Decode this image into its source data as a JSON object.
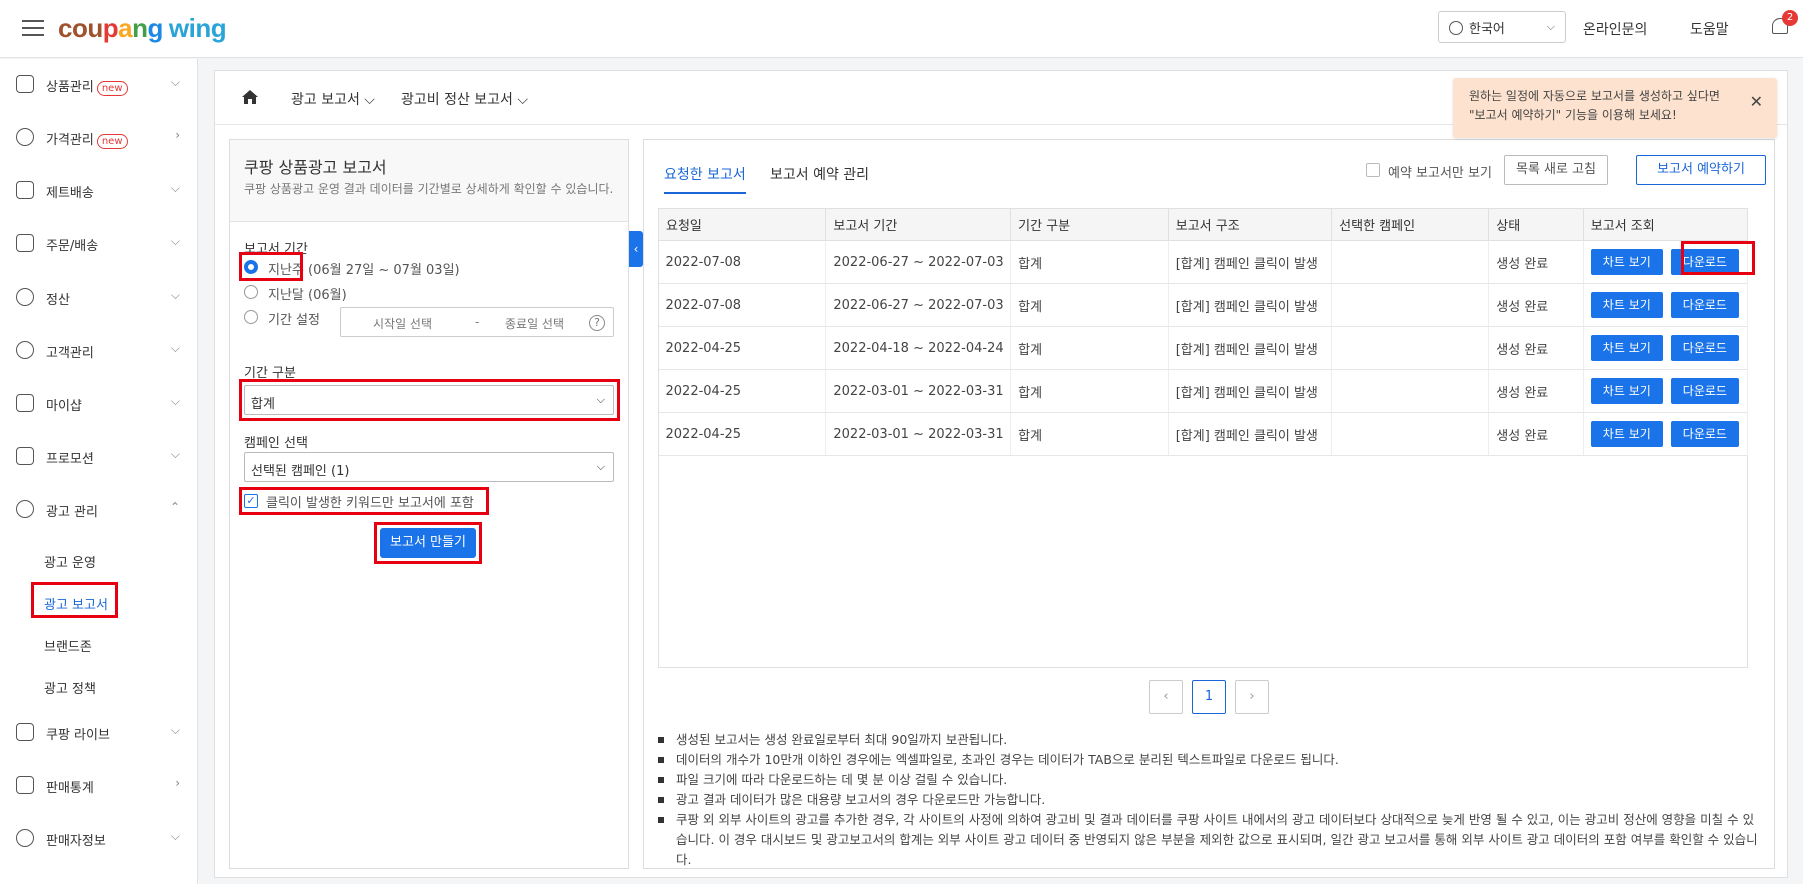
{
  "header": {
    "logo": {
      "c1": "cou",
      "c2": "p",
      "c3": "a",
      "c4": "n",
      "c5": "g",
      "wing": "wing"
    },
    "language": "한국어",
    "links": [
      "온라인문의",
      "도움말"
    ],
    "notification_count": "2"
  },
  "sidebar": {
    "items": [
      {
        "label": "상품관리",
        "new": "new",
        "icon": "box-icon"
      },
      {
        "label": "가격관리",
        "new": "new",
        "icon": "medal-icon"
      },
      {
        "label": "제트배송",
        "icon": "rocket-icon"
      },
      {
        "label": "주문/배송",
        "icon": "truck-icon"
      },
      {
        "label": "정산",
        "icon": "won-icon"
      },
      {
        "label": "고객관리",
        "icon": "smile-icon"
      },
      {
        "label": "마이샵",
        "icon": "shop-icon"
      },
      {
        "label": "프로모션",
        "icon": "ticket-icon"
      },
      {
        "label": "광고 관리",
        "icon": "clock-icon"
      },
      {
        "label": "쿠팡 라이브",
        "icon": "live-icon"
      },
      {
        "label": "판매통계",
        "icon": "chart-icon"
      },
      {
        "label": "판매자정보",
        "icon": "user-icon"
      }
    ],
    "sub_items": [
      "광고 운영",
      "광고 보고서",
      "브랜드존",
      "광고 정책"
    ]
  },
  "breadcrumb": {
    "first": "광고 보고서",
    "second": "광고비 정산 보고서"
  },
  "tooltip": {
    "text": "원하는 일정에 자동으로 보고서를 생성하고 싶다면 \"보고서 예약하기\" 기능을 이용해 보세요!",
    "close": "✕"
  },
  "left_panel": {
    "title": "쿠팡 상품광고 보고서",
    "description": "쿠팡 상품광고 운영 결과 데이터를 기간별로 상세하게 확인할 수 있습니다.",
    "period_label": "보고서 기간",
    "period_options": {
      "last_week": "지난주",
      "last_week_range": "(06월 27일 ~ 07월 03일)",
      "last_month": "지난달 (06월)",
      "custom": "기간 설정"
    },
    "start_date": "시작일 선택",
    "end_date": "종료일 선택",
    "dash": "-",
    "help": "?",
    "breakdown_label": "기간 구분",
    "breakdown_value": "합계",
    "campaign_label": "캠페인 선택",
    "campaign_value": "선택된 캠페인 (1)",
    "checkbox_label": "클릭이 발생한 키워드만 보고서에 포함",
    "create_button": "보고서 만들기"
  },
  "right_panel": {
    "tabs": [
      "요청한 보고서",
      "보고서 예약 관리"
    ],
    "reserved_only": "예약 보고서만 보기",
    "refresh_button": "목록 새로 고침",
    "reserve_button": "보고서 예약하기",
    "table": {
      "headers": [
        "요청일",
        "보고서 기간",
        "기간 구분",
        "보고서 구조",
        "선택한 캠페인",
        "상태",
        "보고서 조회"
      ],
      "rows": [
        {
          "date": "2022-07-08",
          "period": "2022-06-27 ~ 2022-07-03",
          "type": "합계",
          "structure": "[합계] 캠페인 클릭이 발생",
          "campaign": "",
          "status": "생성 완료"
        },
        {
          "date": "2022-07-08",
          "period": "2022-06-27 ~ 2022-07-03",
          "type": "합계",
          "structure": "[합계] 캠페인 클릭이 발생",
          "campaign": "",
          "status": "생성 완료"
        },
        {
          "date": "2022-04-25",
          "period": "2022-04-18 ~ 2022-04-24",
          "type": "합계",
          "structure": "[합계] 캠페인 클릭이 발생",
          "campaign": "",
          "status": "생성 완료"
        },
        {
          "date": "2022-04-25",
          "period": "2022-03-01 ~ 2022-03-31",
          "type": "합계",
          "structure": "[합계] 캠페인 클릭이 발생",
          "campaign": "",
          "status": "생성 완료"
        },
        {
          "date": "2022-04-25",
          "period": "2022-03-01 ~ 2022-03-31",
          "type": "합계",
          "structure": "[합계] 캠페인 클릭이 발생",
          "campaign": "",
          "status": "생성 완료"
        }
      ],
      "chart_btn": "차트 보기",
      "download_btn": "다운로드"
    },
    "pagination": {
      "prev": "‹",
      "current": "1",
      "next": "›"
    },
    "notes": [
      "생성된 보고서는 생성 완료일로부터 최대 90일까지 보관됩니다.",
      "데이터의 개수가 10만개 이하인 경우에는 엑셀파일로, 초과인 경우는 데이터가 TAB으로 분리된 텍스트파일로 다운로드 됩니다.",
      "파일 크기에 따라 다운로드하는 데 몇 분 이상 걸릴 수 있습니다.",
      "광고 결과 데이터가 많은 대용량 보고서의 경우 다운로드만 가능합니다.",
      "쿠팡 외 외부 사이트의 광고를 추가한 경우, 각 사이트의 사정에 의하여 광고비 및 결과 데이터를 쿠팡 사이트 내에서의 광고 데이터보다 상대적으로 늦게 반영 될 수 있고, 이는 광고비 정산에 영향을 미칠 수 있습니다. 이 경우 대시보드 및 광고보고서의 합계는 외부 사이트 광고 데이터 중 반영되지 않은 부분을 제외한 값으로 표시되며, 일간 광고 보고서를 통해 외부 사이트 광고 데이터의 포함 여부를 확인할 수 있습니다."
    ]
  },
  "colors": {
    "primary": "#1a73e8",
    "highlight": "#e60012",
    "tooltip_bg": "#fde3cf"
  }
}
